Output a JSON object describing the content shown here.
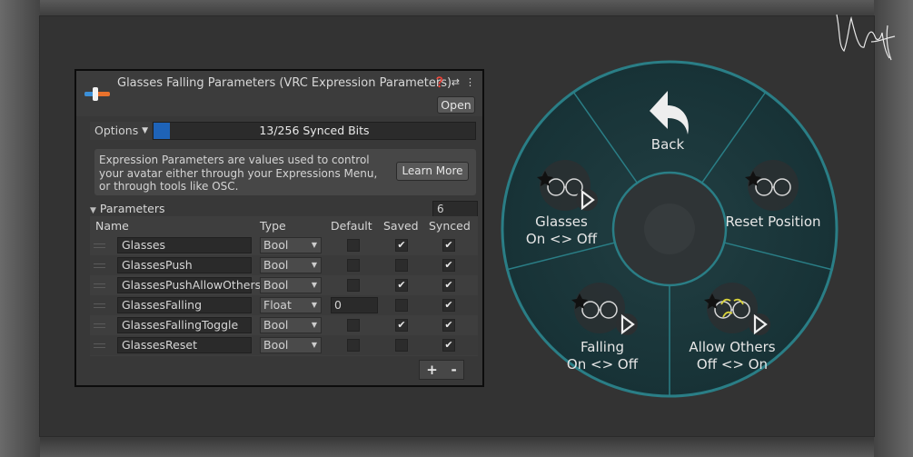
{
  "panel": {
    "title": "Glasses Falling Parameters (VRC Expression Parameters)",
    "header_icons": [
      "help-icon",
      "settings-sliders-icon",
      "kebab-menu-icon"
    ],
    "open_label": "Open",
    "options_label": "Options",
    "synced_bits": {
      "text": "13/256 Synced Bits",
      "used": 13,
      "total": 256
    },
    "help_text": "Expression Parameters are values used to control your avatar either through your Expressions Menu, or through tools like OSC.",
    "learn_more_label": "Learn More",
    "parameters_label": "Parameters",
    "parameter_count": "6",
    "columns": {
      "name": "Name",
      "type": "Type",
      "default": "Default",
      "saved": "Saved",
      "synced": "Synced"
    },
    "rows": [
      {
        "name": "GlassesReset",
        "type": "Bool",
        "default": false,
        "saved": false,
        "synced": true
      },
      {
        "name": "GlassesFallingToggle",
        "type": "Bool",
        "default": false,
        "saved": true,
        "synced": true
      },
      {
        "name": "GlassesFalling",
        "type": "Float",
        "default": "0",
        "saved": false,
        "synced": true
      },
      {
        "name": "GlassesPushAllowOthers",
        "type": "Bool",
        "default": false,
        "saved": true,
        "synced": true
      },
      {
        "name": "GlassesPush",
        "type": "Bool",
        "default": false,
        "saved": false,
        "synced": true
      },
      {
        "name": "Glasses",
        "type": "Bool",
        "default": false,
        "saved": true,
        "synced": true
      }
    ],
    "add_label": "+",
    "remove_label": "-"
  },
  "radial_menu": {
    "back_label": "Back",
    "items": [
      {
        "label": "Glasses",
        "sublabel": "On <> Off",
        "icon": "glasses-toggle-icon"
      },
      {
        "label": "Reset Position",
        "sublabel": "",
        "icon": "glasses-reset-icon"
      },
      {
        "label": "Falling",
        "sublabel": "On <> Off",
        "icon": "glasses-falling-icon"
      },
      {
        "label": "Allow Others",
        "sublabel": "Off <> On",
        "icon": "allow-others-icon"
      }
    ],
    "accent_color": "#1f6e78",
    "fill_color": "#1a3a3e"
  },
  "colors": {
    "synced_bar": "#1e63b8",
    "panel_bg": "#383838"
  }
}
